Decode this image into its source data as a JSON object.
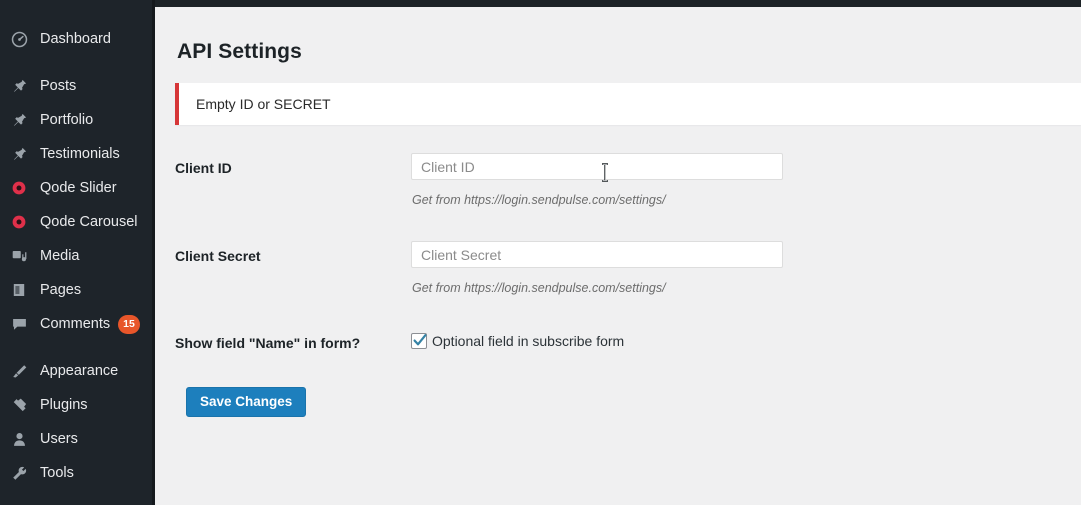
{
  "sidebar": {
    "items": [
      {
        "label": "Dashboard",
        "icon": "dashboard-icon",
        "badge": null,
        "separator_after": true
      },
      {
        "label": "Posts",
        "icon": "pin-icon",
        "badge": null,
        "separator_after": false
      },
      {
        "label": "Portfolio",
        "icon": "pin-icon",
        "badge": null,
        "separator_after": false
      },
      {
        "label": "Testimonials",
        "icon": "pin-icon",
        "badge": null,
        "separator_after": false
      },
      {
        "label": "Qode Slider",
        "icon": "qode-circle-icon",
        "badge": null,
        "separator_after": false
      },
      {
        "label": "Qode Carousel",
        "icon": "qode-circle-icon",
        "badge": null,
        "separator_after": false
      },
      {
        "label": "Media",
        "icon": "media-icon",
        "badge": null,
        "separator_after": false
      },
      {
        "label": "Pages",
        "icon": "pages-icon",
        "badge": null,
        "separator_after": false
      },
      {
        "label": "Comments",
        "icon": "comment-icon",
        "badge": "15",
        "separator_after": true
      },
      {
        "label": "Appearance",
        "icon": "appearance-brush-icon",
        "badge": null,
        "separator_after": false
      },
      {
        "label": "Plugins",
        "icon": "plugins-icon",
        "badge": null,
        "separator_after": false
      },
      {
        "label": "Users",
        "icon": "users-icon",
        "badge": null,
        "separator_after": false
      },
      {
        "label": "Tools",
        "icon": "tools-wrench-icon",
        "badge": null,
        "separator_after": false
      }
    ]
  },
  "main": {
    "title": "API Settings",
    "notice": {
      "text": "Empty ID or SECRET",
      "accent_color": "#d63638"
    },
    "fields": {
      "client_id": {
        "label": "Client ID",
        "value": "",
        "placeholder": "Client ID",
        "help": "Get from https://login.sendpulse.com/settings/"
      },
      "client_secret": {
        "label": "Client Secret",
        "value": "",
        "placeholder": "Client Secret",
        "help": "Get from https://login.sendpulse.com/settings/"
      },
      "show_name": {
        "label": "Show field \"Name\" in form?",
        "checkbox_label": "Optional field in subscribe form",
        "checked": true
      }
    },
    "save_button": "Save Changes"
  },
  "colors": {
    "sidebar_bg": "#1e242a",
    "accent_button": "#1d7fbd",
    "notice_accent": "#d63638",
    "badge": "#e8562a",
    "checkbox_check": "#3582a5"
  }
}
